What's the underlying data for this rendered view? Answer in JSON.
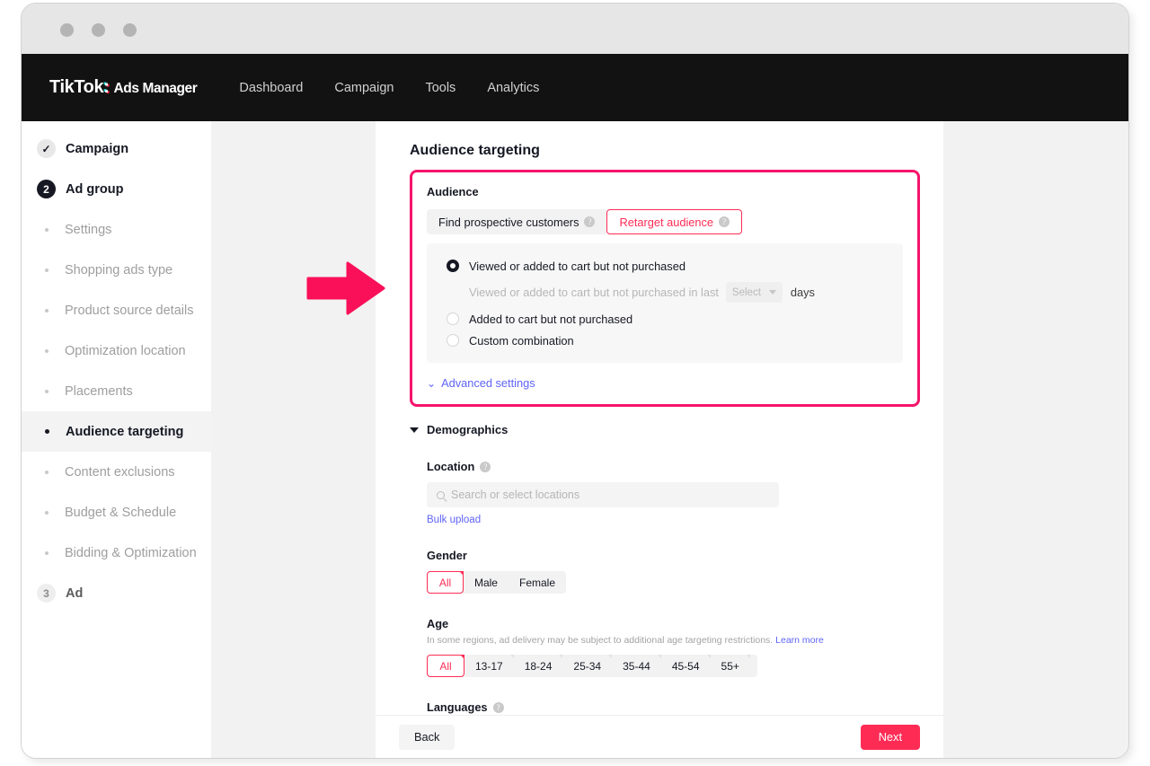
{
  "window": {
    "dots": [
      "close-dot",
      "minimize-dot",
      "maximize-dot"
    ]
  },
  "appbar": {
    "logo_main": "TikTok",
    "logo_colon": ":",
    "logo_sub": "Ads Manager",
    "nav": [
      {
        "label": "Dashboard"
      },
      {
        "label": "Campaign"
      },
      {
        "label": "Tools"
      },
      {
        "label": "Analytics"
      }
    ]
  },
  "sidebar": {
    "steps": [
      {
        "badge": "✓",
        "label": "Campaign",
        "state": "done"
      },
      {
        "badge": "2",
        "label": "Ad group",
        "state": "active"
      },
      {
        "badge": "3",
        "label": "Ad",
        "state": "idle"
      }
    ],
    "adgroup_items": [
      {
        "label": "Settings",
        "selected": false
      },
      {
        "label": "Shopping ads type",
        "selected": false
      },
      {
        "label": "Product source details",
        "selected": false
      },
      {
        "label": "Optimization location",
        "selected": false
      },
      {
        "label": "Placements",
        "selected": false
      },
      {
        "label": "Audience targeting",
        "selected": true
      },
      {
        "label": "Content exclusions",
        "selected": false
      },
      {
        "label": "Budget & Schedule",
        "selected": false
      },
      {
        "label": "Bidding & Optimization",
        "selected": false
      }
    ]
  },
  "main": {
    "page_title": "Audience targeting",
    "audience": {
      "label": "Audience",
      "tabs": [
        {
          "label": "Find prospective customers",
          "active": false
        },
        {
          "label": "Retarget audience",
          "active": true
        }
      ],
      "options": [
        {
          "label": "Viewed or added to cart but not purchased",
          "checked": true
        },
        {
          "label": "Added to cart but not purchased",
          "checked": false
        },
        {
          "label": "Custom combination",
          "checked": false
        }
      ],
      "lookback": {
        "prefix": "Viewed or added to cart but not purchased in last",
        "select_placeholder": "Select",
        "suffix": "days"
      },
      "advanced_settings": "Advanced settings"
    },
    "demographics": {
      "title": "Demographics",
      "location": {
        "label": "Location",
        "placeholder": "Search or select locations",
        "bulk_upload": "Bulk upload"
      },
      "gender": {
        "label": "Gender",
        "options": [
          "All",
          "Male",
          "Female"
        ],
        "selected": "All"
      },
      "age": {
        "label": "Age",
        "note": "In some regions, ad delivery may be subject to additional age targeting restrictions.",
        "learn_more": "Learn more",
        "options": [
          "All",
          "13-17",
          "18-24",
          "25-34",
          "35-44",
          "45-54",
          "55+"
        ],
        "selected": "All"
      },
      "languages": {
        "label": "Languages"
      }
    }
  },
  "footer": {
    "back_label": "Back",
    "next_label": "Next"
  },
  "colors": {
    "brand_pink": "#fe2c55",
    "highlight_pink": "#f5146b",
    "link_blue": "#5f64f5",
    "appbar_black": "#121212"
  }
}
